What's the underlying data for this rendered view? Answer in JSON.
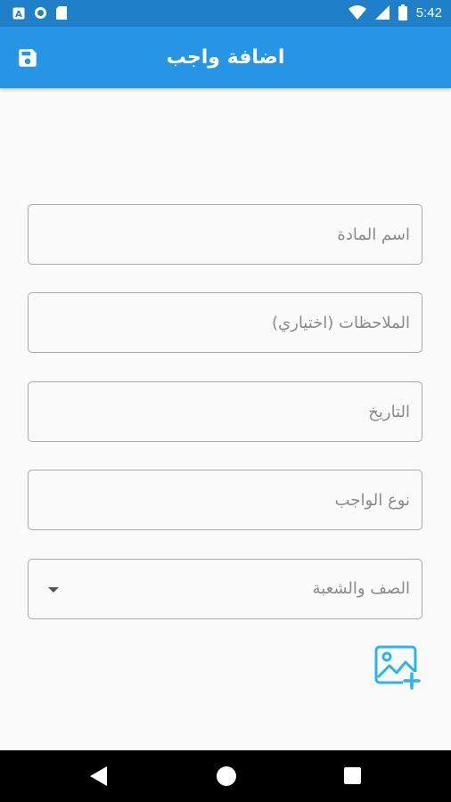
{
  "status_bar": {
    "time": "5:42",
    "icons": [
      "app-a-icon",
      "circle-icon",
      "sd-card-icon",
      "wifi-icon",
      "signal-icon",
      "battery-icon"
    ]
  },
  "app_bar": {
    "title": "اضافة واجب",
    "save_icon": "save-icon",
    "background": "#2795e6"
  },
  "form": {
    "subject_name": {
      "placeholder": "اسم المادة",
      "value": ""
    },
    "notes": {
      "placeholder": "الملاحظات (اختياري)",
      "value": ""
    },
    "date": {
      "placeholder": "التاريخ",
      "value": ""
    },
    "homework_type": {
      "placeholder": "نوع الواجب",
      "value": ""
    },
    "class_section": {
      "placeholder": "الصف والشعبة"
    },
    "add_image_icon": "add-image-icon",
    "accent": "#2bb5e8"
  },
  "nav": {
    "icons": [
      "back-icon",
      "home-icon",
      "recents-icon"
    ]
  }
}
